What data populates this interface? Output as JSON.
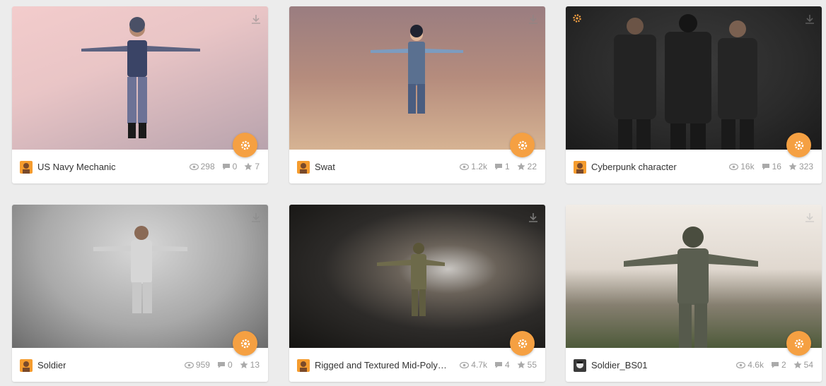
{
  "cards": [
    {
      "title": "US Navy Mechanic",
      "views": "298",
      "comments": "0",
      "likes": "7",
      "staffpick": false
    },
    {
      "title": "Swat",
      "views": "1.2k",
      "comments": "1",
      "likes": "22",
      "staffpick": false
    },
    {
      "title": "Cyberpunk character",
      "views": "16k",
      "comments": "16",
      "likes": "323",
      "staffpick": true
    },
    {
      "title": "Soldier",
      "views": "959",
      "comments": "0",
      "likes": "13",
      "staffpick": false
    },
    {
      "title": "Rigged and Textured Mid-Poly Soldier",
      "views": "4.7k",
      "comments": "4",
      "likes": "55",
      "staffpick": false
    },
    {
      "title": "Soldier_BS01",
      "views": "4.6k",
      "comments": "2",
      "likes": "54",
      "staffpick": false
    }
  ],
  "colors": {
    "accent": "#f5a042",
    "text": "#333333",
    "muted": "#999999"
  }
}
